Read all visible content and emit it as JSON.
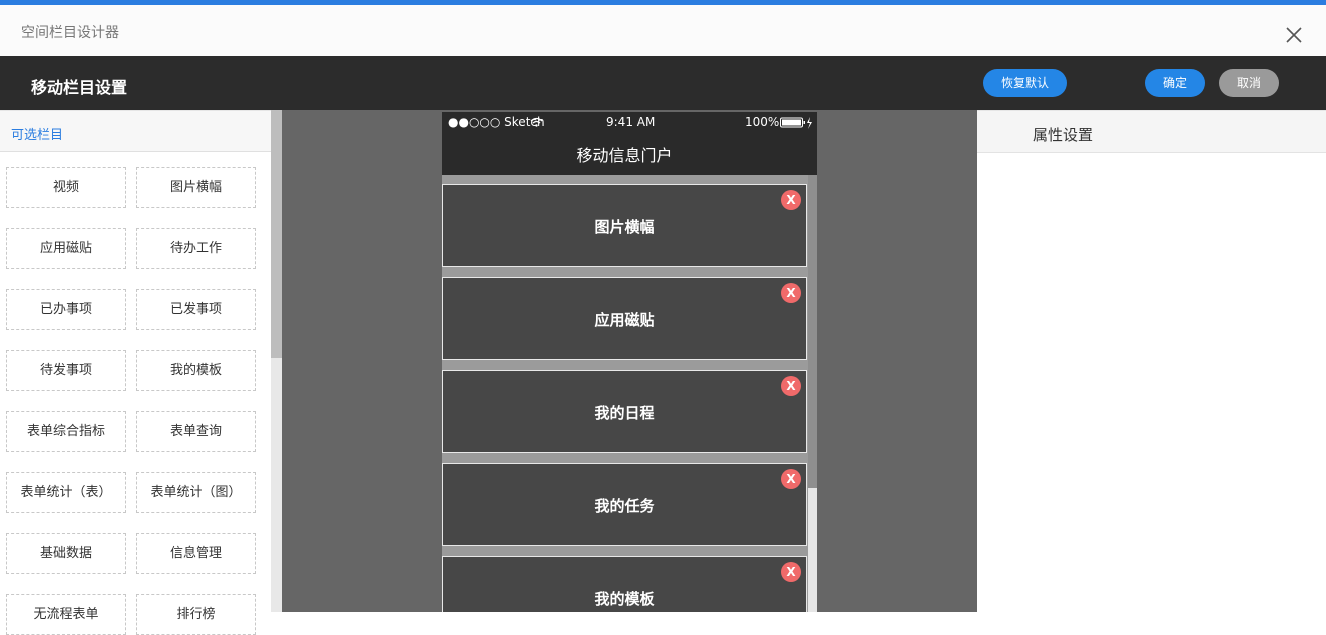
{
  "window": {
    "title": "空间栏目设计器"
  },
  "header": {
    "title": "移动栏目设置",
    "restore_label": "恢复默认",
    "ok_label": "确定",
    "cancel_label": "取消"
  },
  "left_panel": {
    "title": "可选栏目",
    "items": [
      "视频",
      "图片横幅",
      "应用磁贴",
      "待办工作",
      "已办事项",
      "已发事项",
      "待发事项",
      "我的模板",
      "表单综合指标",
      "表单查询",
      "表单统计（表）",
      "表单统计（图）",
      "基础数据",
      "信息管理",
      "无流程表单",
      "排行榜"
    ]
  },
  "phone": {
    "status": {
      "carrier": "●●○○○ Sketch",
      "time": "9:41 AM",
      "battery": "100%"
    },
    "nav_title": "移动信息门户",
    "modules": [
      "图片横幅",
      "应用磁贴",
      "我的日程",
      "我的任务",
      "我的模板"
    ],
    "delete_label": "X"
  },
  "right_panel": {
    "title": "属性设置"
  },
  "colors": {
    "accent": "#2486e6",
    "header_bg": "#2c2c2c",
    "delete": "#f06a6a"
  }
}
